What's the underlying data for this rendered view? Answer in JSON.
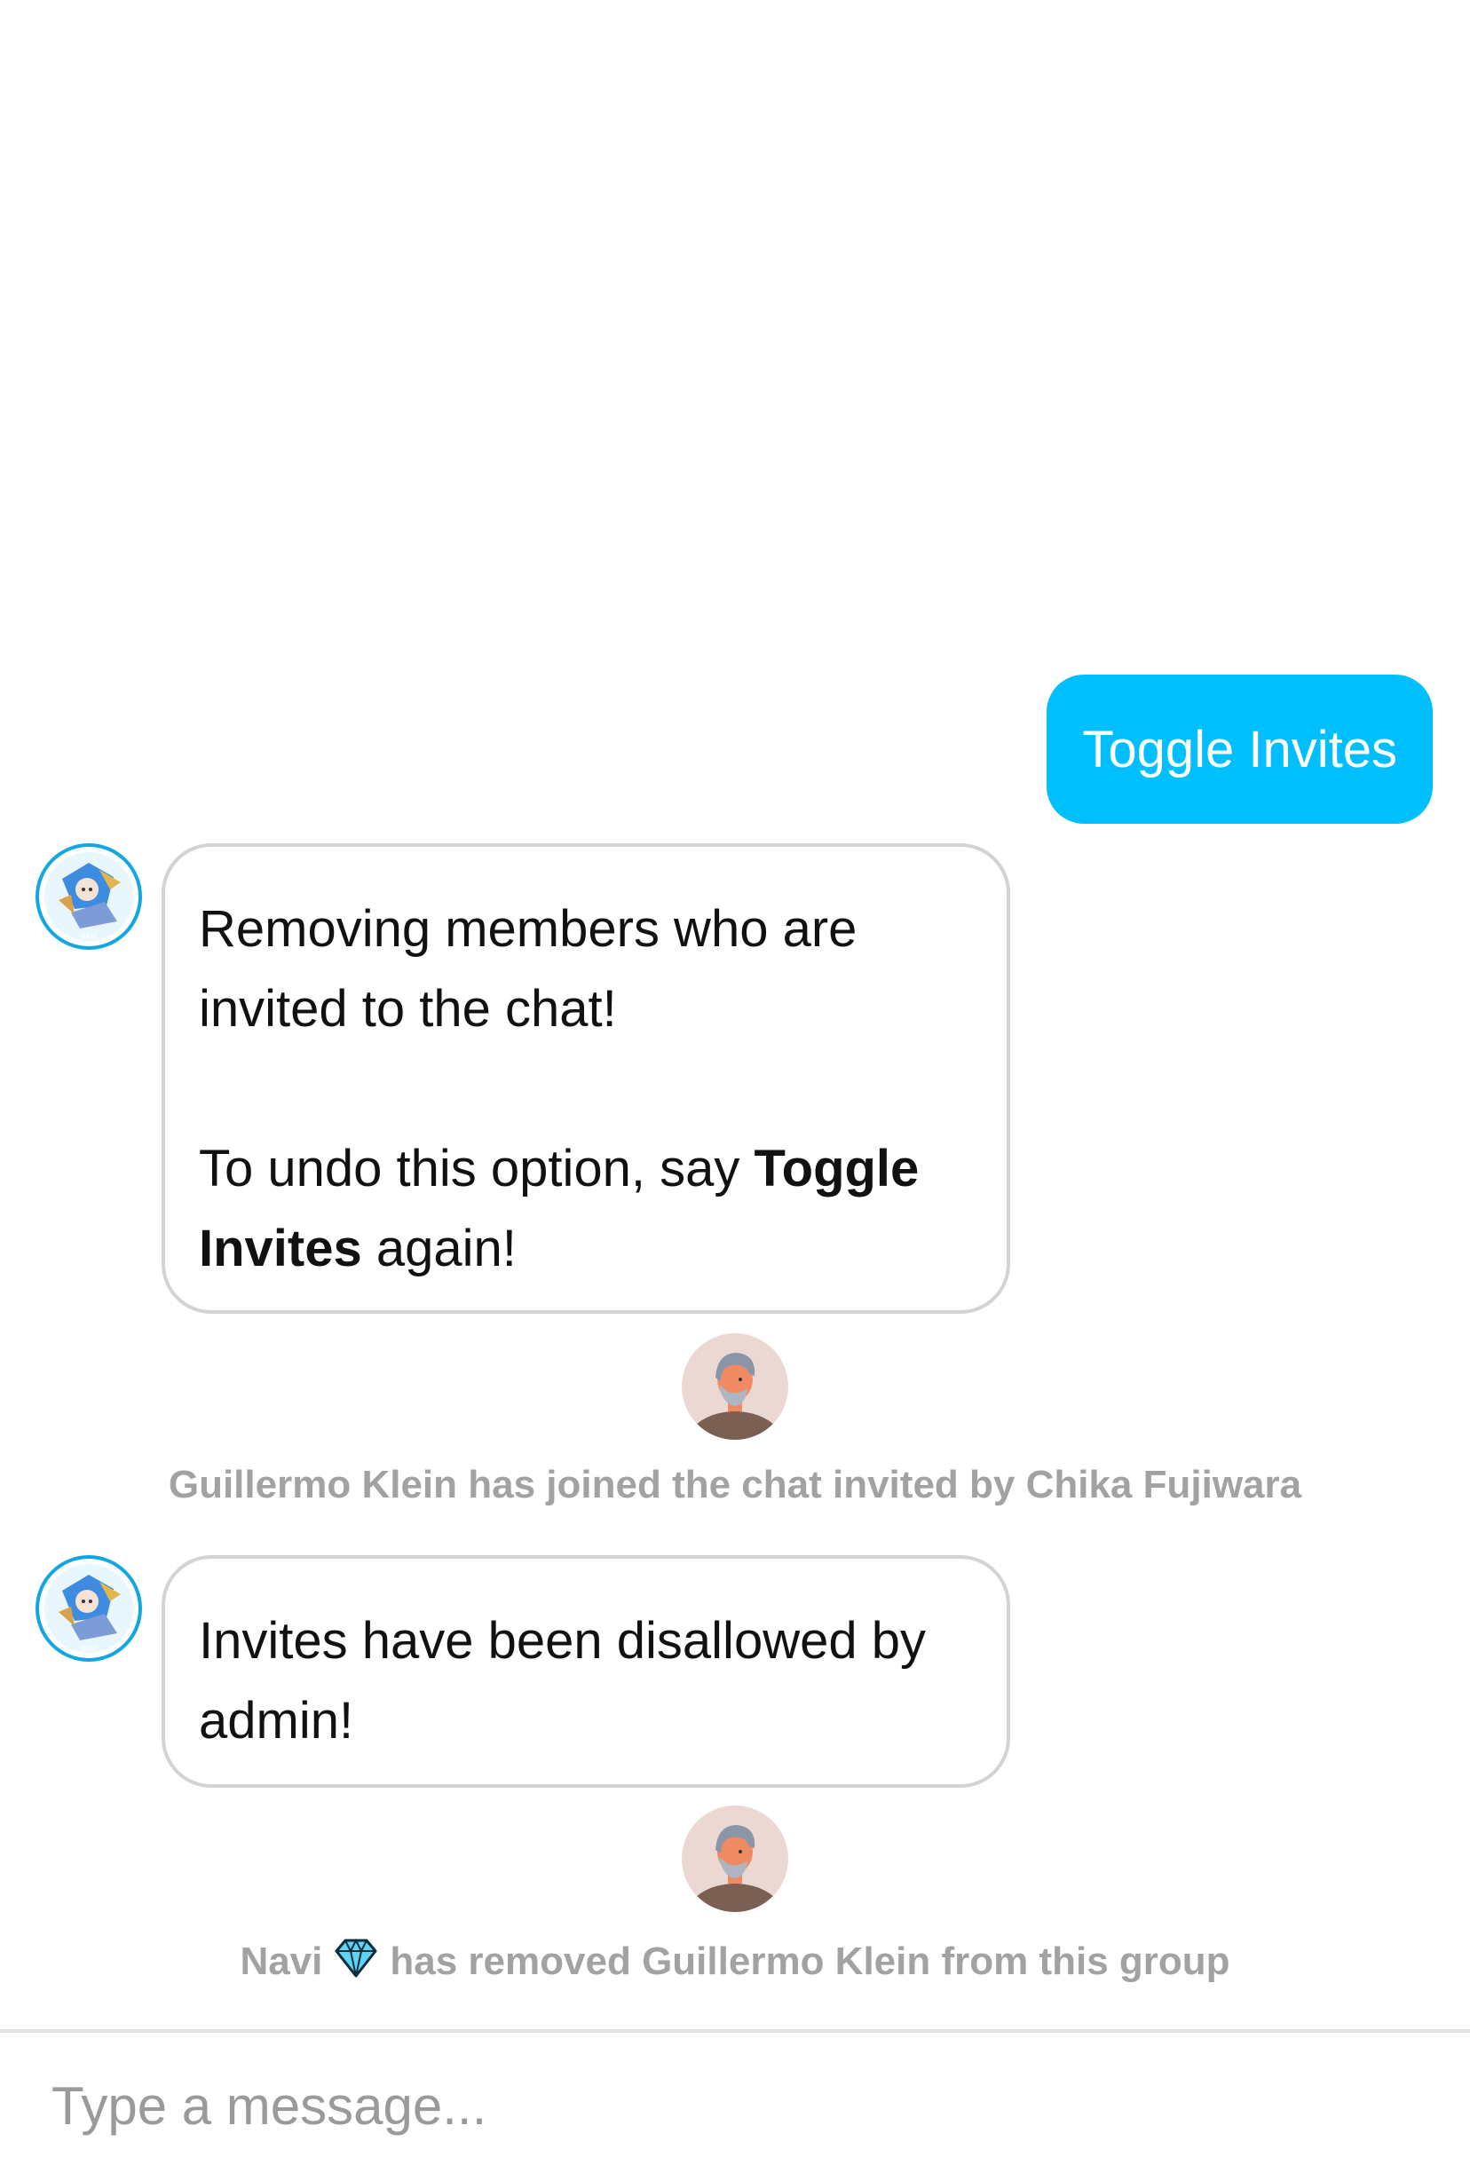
{
  "messages": {
    "outgoing": {
      "text": "Toggle Invites"
    },
    "bot1": {
      "avatar_label": "NAVI",
      "line1": "Removing members who are invited to the chat!",
      "line2_prefix": "To undo this option, say ",
      "line2_bold": "Toggle Invites",
      "line2_suffix": " again!"
    },
    "system1": {
      "text": "Guillermo Klein has joined the chat invited by Chika Fujiwara"
    },
    "bot2": {
      "avatar_label": "NAVI",
      "text": "Invites have been disallowed by admin!"
    },
    "system2": {
      "actor": "Navi",
      "actor_icon": "gem-icon",
      "text": "has removed Guillermo Klein from this group"
    }
  },
  "composer": {
    "placeholder": "Type a message..."
  },
  "colors": {
    "outgoing_bubble": "#00bfff",
    "incoming_border": "#d3d3d3",
    "system_text": "#a2a2a2",
    "bot_avatar_ring": "#12a7e3",
    "user_avatar_bg": "#ecd8d2"
  }
}
